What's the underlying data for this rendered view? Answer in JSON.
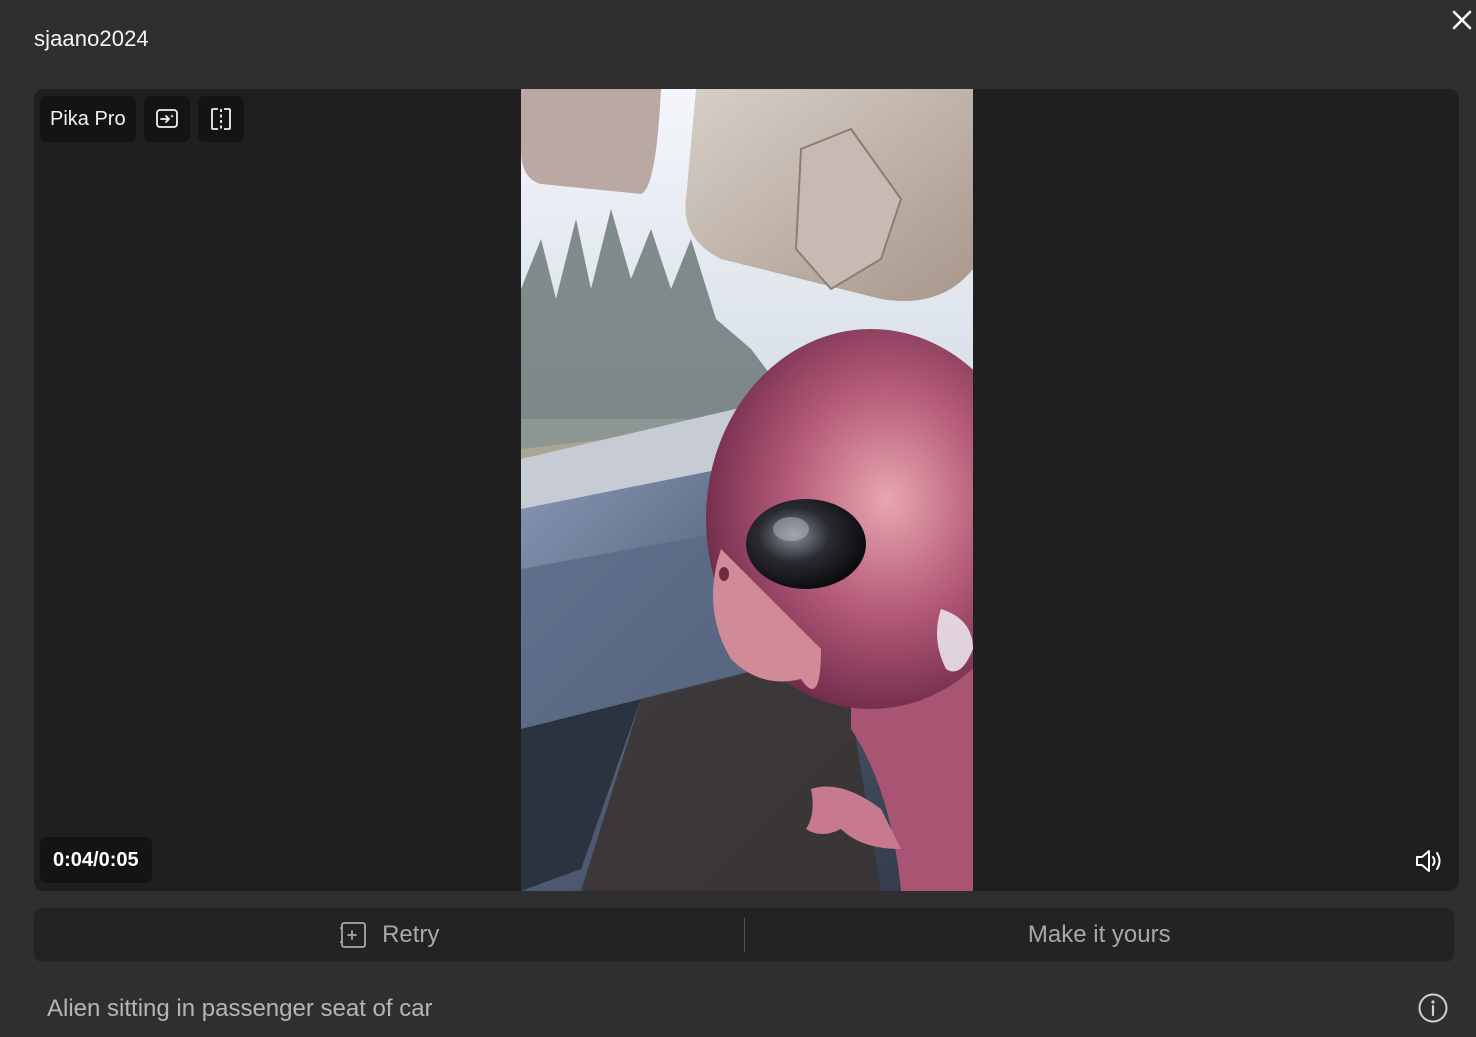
{
  "header": {
    "username": "sjaano2024",
    "close_icon": "close-icon"
  },
  "player": {
    "model_badge": "Pika Pro",
    "badge_icons": [
      "image-to-video-icon",
      "split-compare-icon"
    ],
    "time_current": "0:04",
    "time_total": "0:05",
    "time_display": "0:04/0:05",
    "volume_icon": "volume-icon",
    "video_description": "Alien sitting in passenger seat of car"
  },
  "actions": {
    "retry_label": "Retry",
    "retry_icon": "retry-icon",
    "make_it_yours_label": "Make it yours"
  },
  "footer": {
    "prompt_text": "Alien sitting in passenger seat of car",
    "info_icon": "info-icon"
  },
  "colors": {
    "background": "#2f2f2f",
    "player_bg": "#1f1f1f",
    "badge_bg": "#141414",
    "action_bar_bg": "#232323",
    "muted_text": "#a8a8a8"
  }
}
